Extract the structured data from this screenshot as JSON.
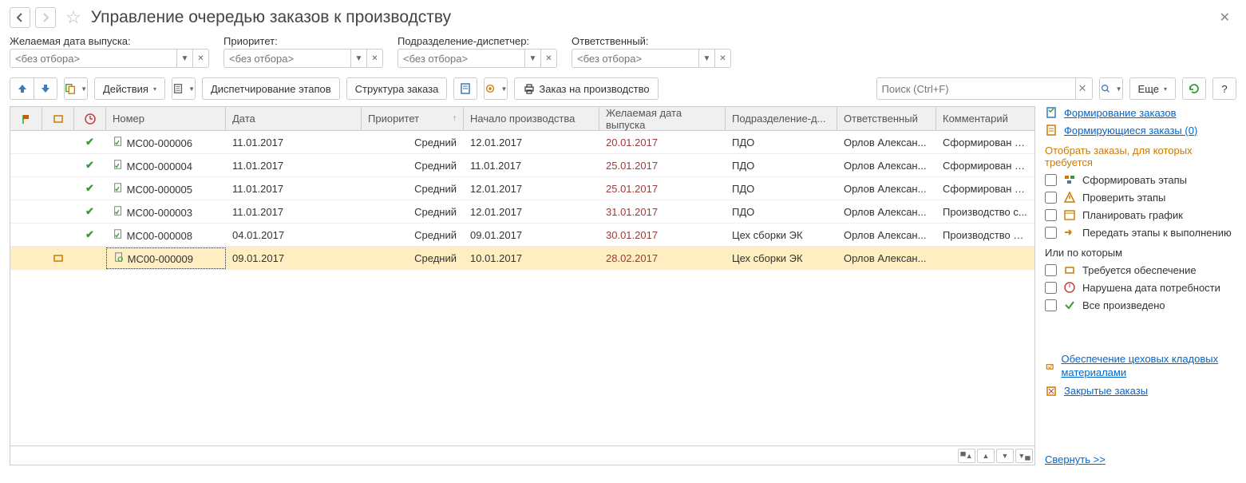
{
  "header": {
    "title": "Управление очередью заказов к производству"
  },
  "filters": {
    "desired_date": {
      "label": "Желаемая дата выпуска:",
      "placeholder": "<без отбора>"
    },
    "priority": {
      "label": "Приоритет:",
      "placeholder": "<без отбора>"
    },
    "department": {
      "label": "Подразделение-диспетчер:",
      "placeholder": "<без отбора>"
    },
    "responsible": {
      "label": "Ответственный:",
      "placeholder": "<без отбора>"
    }
  },
  "toolbar": {
    "actions": "Действия",
    "dispatch": "Диспетчирование этапов",
    "structure": "Структура заказа",
    "order": "Заказ на производство",
    "search_placeholder": "Поиск (Ctrl+F)",
    "more": "Еще"
  },
  "table": {
    "columns": {
      "number": "Номер",
      "date": "Дата",
      "priority": "Приоритет",
      "start": "Начало производства",
      "desired": "Желаемая дата выпуска",
      "department": "Подразделение-д...",
      "responsible": "Ответственный",
      "comment": "Комментарий"
    },
    "rows": [
      {
        "status": "ok",
        "icon": "pass",
        "number": "МС00-000006",
        "date": "11.01.2017",
        "priority": "Средний",
        "start": "12.01.2017",
        "desired": "20.01.2017",
        "department": "ПДО",
        "responsible": "Орлов Алексан...",
        "comment": "Сформирован а...",
        "selected": false
      },
      {
        "status": "ok",
        "icon": "pass",
        "number": "МС00-000004",
        "date": "11.01.2017",
        "priority": "Средний",
        "start": "11.01.2017",
        "desired": "25.01.2017",
        "department": "ПДО",
        "responsible": "Орлов Алексан...",
        "comment": "Сформирован а...",
        "selected": false
      },
      {
        "status": "ok",
        "icon": "pass",
        "number": "МС00-000005",
        "date": "11.01.2017",
        "priority": "Средний",
        "start": "12.01.2017",
        "desired": "25.01.2017",
        "department": "ПДО",
        "responsible": "Орлов Алексан...",
        "comment": "Сформирован а...",
        "selected": false
      },
      {
        "status": "ok",
        "icon": "pass",
        "number": "МС00-000003",
        "date": "11.01.2017",
        "priority": "Средний",
        "start": "12.01.2017",
        "desired": "31.01.2017",
        "department": "ПДО",
        "responsible": "Орлов Алексан...",
        "comment": "Производство с...",
        "selected": false
      },
      {
        "status": "ok",
        "icon": "pass",
        "number": "МС00-000008",
        "date": "04.01.2017",
        "priority": "Средний",
        "start": "09.01.2017",
        "desired": "30.01.2017",
        "department": "Цех сборки ЭК",
        "responsible": "Орлов Алексан...",
        "comment": "Производство п...",
        "selected": false
      },
      {
        "status": "",
        "icon": "hold",
        "number": "МС00-000009",
        "date": "09.01.2017",
        "priority": "Средний",
        "start": "10.01.2017",
        "desired": "28.02.2017",
        "department": "Цех сборки ЭК",
        "responsible": "Орлов Алексан...",
        "comment": "",
        "selected": true
      }
    ]
  },
  "side": {
    "link_form": "Формирование заказов",
    "link_forming": "Формирующиеся заказы (0)",
    "section1": "Отобрать заказы, для которых требуется",
    "check_form": "Сформировать этапы",
    "check_verify": "Проверить этапы",
    "check_plan": "Планировать график",
    "check_send": "Передать этапы к выполнению",
    "section2": "Или по которым",
    "check_supply": "Требуется обеспечение",
    "check_date": "Нарушена дата потребности",
    "check_done": "Все произведено",
    "link_supply": "Обеспечение цеховых кладовых материалами",
    "link_closed": "Закрытые заказы",
    "collapse": "Свернуть >>"
  }
}
